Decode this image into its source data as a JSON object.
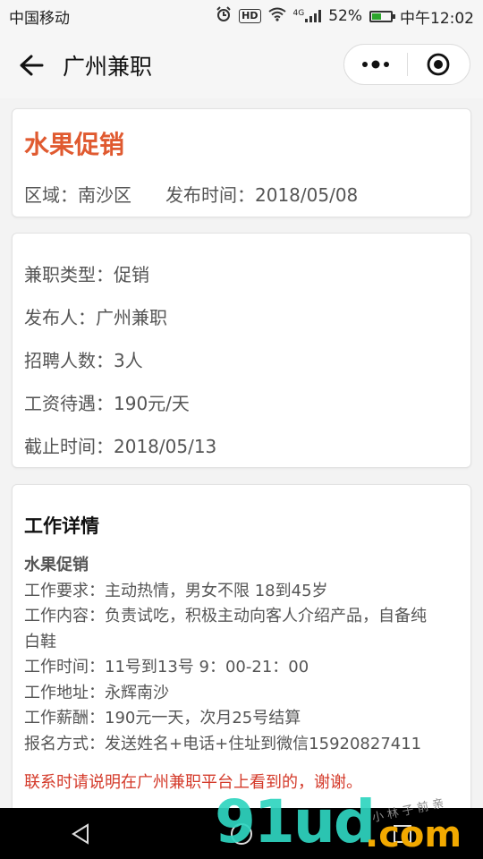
{
  "status_bar": {
    "carrier": "中国移动",
    "network": "4G",
    "battery": "52%",
    "battery_level": 0.52,
    "time": "中午12:02",
    "icons": [
      "alarm-icon",
      "hd-icon",
      "wifi-icon",
      "signal-icon",
      "battery-icon"
    ]
  },
  "nav": {
    "title": "广州兼职",
    "back_icon": "arrow-left-icon",
    "more_icon": "more-dots-icon",
    "close_icon": "target-circle-icon"
  },
  "job": {
    "title": "水果促销",
    "region_label": "区域：",
    "region": "南沙区",
    "publish_label": "发布时间：",
    "publish_date": "2018/05/08"
  },
  "info": [
    {
      "label": "兼职类型：",
      "value": "促销"
    },
    {
      "label": "发布人：",
      "value": "广州兼职"
    },
    {
      "label": "招聘人数：",
      "value": "3人"
    },
    {
      "label": "工资待遇：",
      "value": "190元/天"
    },
    {
      "label": "截止时间：",
      "value": "2018/05/13"
    }
  ],
  "detail": {
    "heading": "工作详情",
    "subtitle": "水果促销",
    "lines": [
      "工作要求：主动热情，男女不限 18到45岁",
      "工作内容：负责试吃，积极主动向客人介绍产品，自备纯",
      "白鞋",
      "工作时间：11号到13号 9：00-21：00",
      "工作地址：永辉南沙",
      "工作薪酬：190元一天，次月25号结算",
      "报名方式：发送姓名+电话+住址到微信15920827411"
    ],
    "notice": "联系时请说明在广州兼职平台上看到的，谢谢。"
  },
  "bottom_nav": [
    "back-triangle-icon",
    "home-circle-icon",
    "recents-square-icon"
  ],
  "watermark": {
    "main": "91ud",
    "suffix": ".com",
    "handwriting": "小 林 子 前 亲"
  },
  "colors": {
    "accent": "#e05a30",
    "notice": "#d43a2a",
    "background": "#f3f3f3",
    "watermark_teal": "#2fd5c0",
    "watermark_orange": "#f2a900"
  }
}
